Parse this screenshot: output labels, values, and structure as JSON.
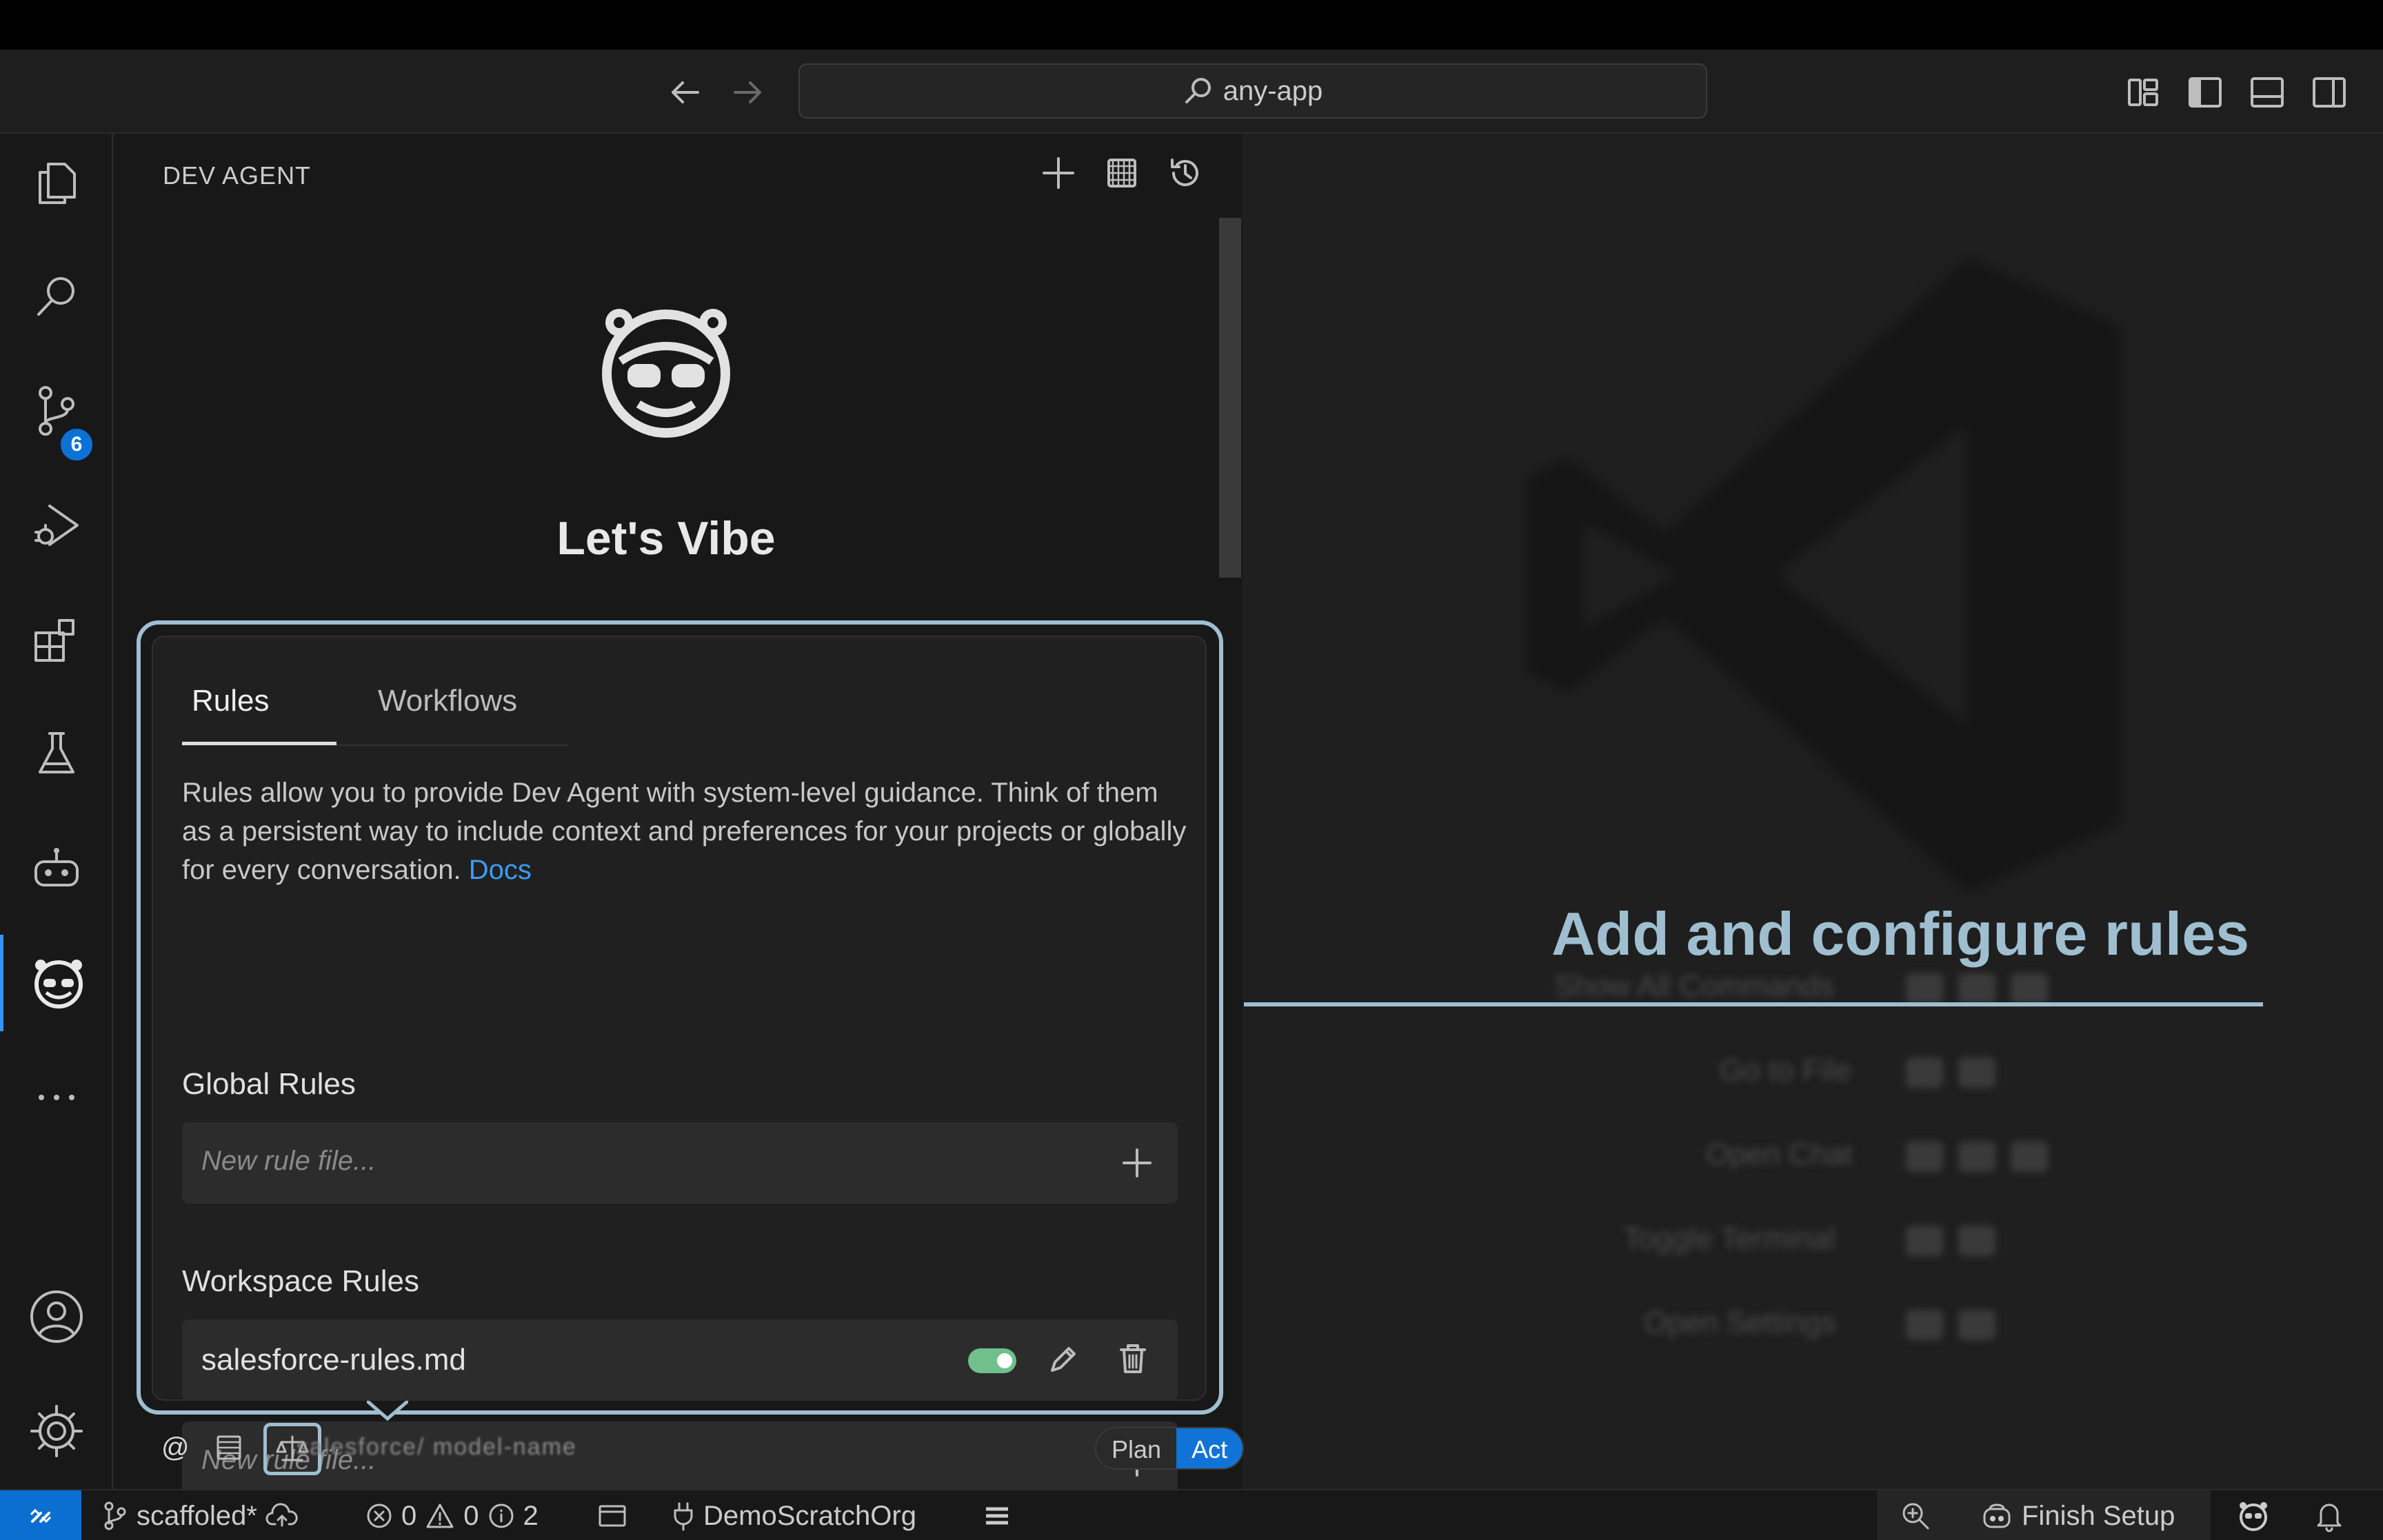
{
  "titlebar": {
    "search_text": "any-app"
  },
  "activity_bar": {
    "scm_badge": "6"
  },
  "sidebar": {
    "title": "DEV AGENT",
    "hero_title": "Let's Vibe",
    "tabs": [
      {
        "label": "Rules",
        "active": true
      },
      {
        "label": "Workflows",
        "active": false
      }
    ],
    "description": "Rules allow you to provide Dev Agent with system-level guidance. Think of them as a persistent way to include context and preferences for your projects or globally for every conversation.",
    "docs_link": "Docs",
    "global_rules": {
      "label": "Global Rules",
      "new_placeholder": "New rule file..."
    },
    "workspace_rules": {
      "label": "Workspace Rules",
      "items": [
        {
          "name": "salesforce-rules.md",
          "enabled": true
        }
      ],
      "new_placeholder": "New rule file..."
    },
    "bottom": {
      "at_symbol": "@",
      "model_text": "salesforce/ model-name",
      "mode_plan": "Plan",
      "mode_act": "Act",
      "mode_selected": "Act"
    }
  },
  "editor": {
    "banner": "Add and configure rules"
  },
  "statusbar": {
    "branch": "scaffoled*",
    "errors": "0",
    "warnings": "0",
    "infos": "2",
    "org": "DemoScratchOrg",
    "finish_setup": "Finish Setup"
  },
  "colors": {
    "accent": "#0a72d6",
    "callout": "#9fbfd0",
    "toggle_on": "#6fc08a",
    "link": "#3b9cf5"
  }
}
